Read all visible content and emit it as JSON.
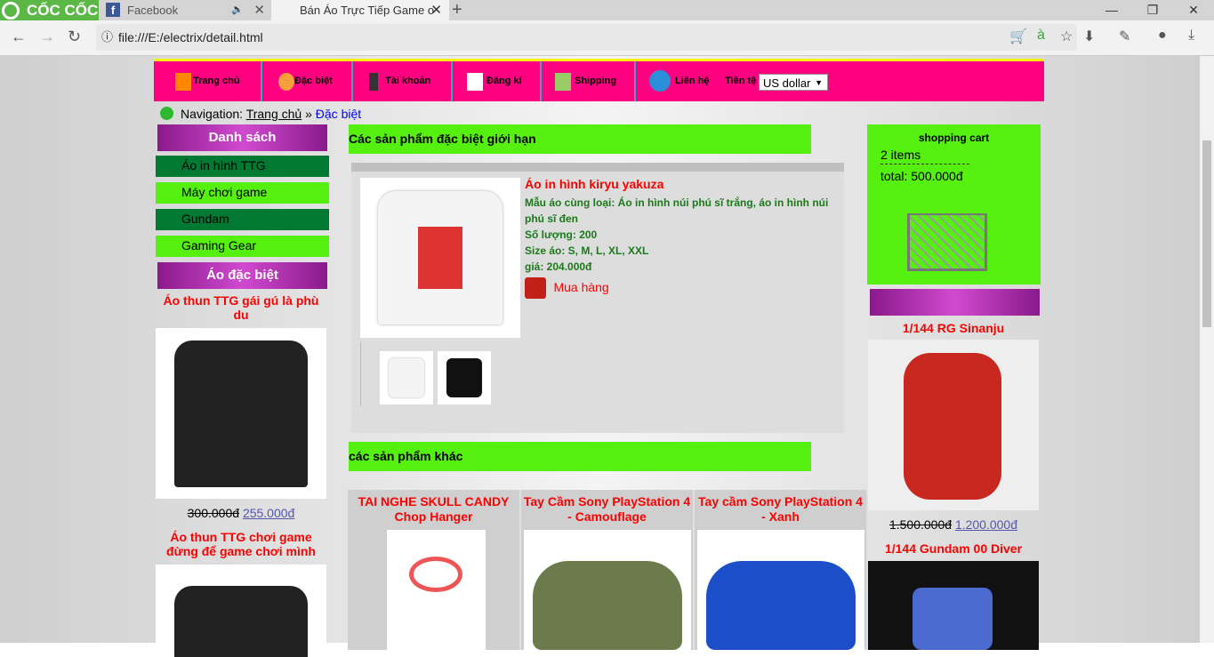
{
  "browser": {
    "brand": "CỐC CỐC",
    "tabs": [
      {
        "title": "Facebook"
      },
      {
        "title": "Bán Áo Trực Tiếp Game o"
      }
    ],
    "url": "file:///E:/electrix/detail.html"
  },
  "menu": {
    "items": [
      {
        "label": "Trang chủ",
        "icon": "home-icon"
      },
      {
        "label": "Đặc biệt",
        "icon": "thumbs-up-icon"
      },
      {
        "label": "Tài khoản",
        "icon": "user-icon"
      },
      {
        "label": "Đăng kí",
        "icon": "register-icon"
      },
      {
        "label": "Shipping",
        "icon": "shipping-icon"
      },
      {
        "label": "Liên hệ",
        "icon": "phone-icon"
      }
    ],
    "currency_label": "Tiền tệ",
    "currency_value": "US dollar"
  },
  "breadcrumb": {
    "prefix": "Navigation:",
    "home": "Trang chủ",
    "sep": "»",
    "current": "Đặc biệt"
  },
  "sidebar": {
    "list_title": "Danh sách",
    "categories": [
      "Áo in hình TTG",
      "Máy chơi game",
      "Gundam",
      "Gaming Gear"
    ],
    "special_title": "Áo đặc biệt",
    "products": [
      {
        "name": "Áo thun TTG gái gú là phù du",
        "old_price": "300.000đ",
        "price": "255.000đ"
      },
      {
        "name": "Áo thun TTG chơi game đừng để game chơi mình"
      }
    ]
  },
  "main": {
    "section_title": "Các sản phẩm đặc biệt giới hạn",
    "product": {
      "name": "Áo in hình kiryu yakuza",
      "similar": "Mẫu áo cùng loại: Áo in hình núi phú sĩ trắng, áo in hình núi phú sĩ đen",
      "quantity": "Số lượng: 200",
      "sizes": "Size áo: S, M, L, XL, XXL",
      "price": "giá: 204.000đ",
      "buy": "Mua hàng"
    },
    "other_title": "các sản phẩm khác",
    "others": [
      {
        "name": "TAI NGHE SKULL CANDY Chop Hanger"
      },
      {
        "name": "Tay Cầm Sony PlayStation 4 - Camouflage"
      },
      {
        "name": "Tay cầm Sony PlayStation 4 - Xanh"
      }
    ]
  },
  "cart": {
    "title": "shopping cart",
    "items": "2 items",
    "total": "total: 500.000đ"
  },
  "right": {
    "products": [
      {
        "name": "1/144 RG Sinanju",
        "old_price": "1.500.000đ",
        "price": "1.200.000đ"
      },
      {
        "name": "1/144 Gundam 00 Diver"
      }
    ]
  },
  "colors": {
    "menu": "#ff0080",
    "green": "#55ef10",
    "dark_green": "#007a33",
    "price_red": "#ff0000"
  }
}
